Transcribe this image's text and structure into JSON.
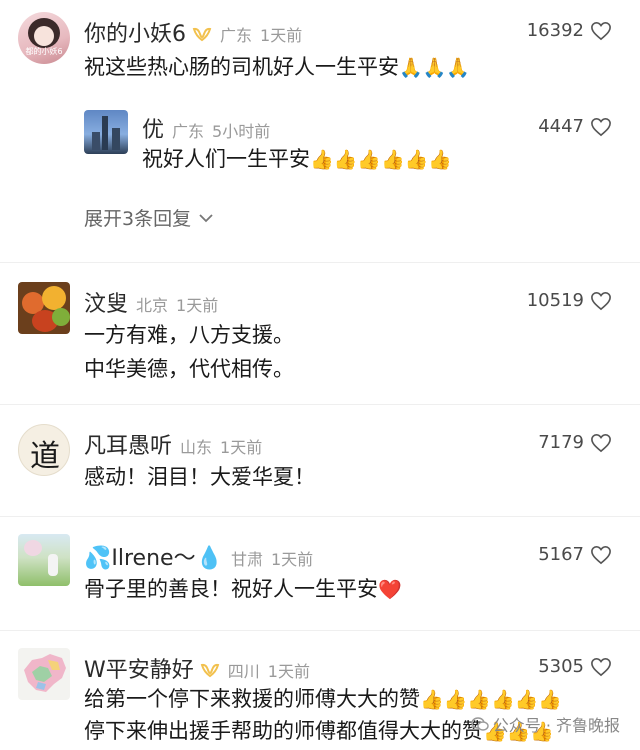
{
  "comments": [
    {
      "user": "你的小妖6",
      "avatar_text": "都的小妖6",
      "location": "广东",
      "time": "1天前",
      "likes": "16392",
      "text": "祝这些热心肠的司机好人一生平安",
      "emoji": "🙏🙏🙏",
      "reply": {
        "user": "优",
        "location": "广东",
        "time": "5小时前",
        "likes": "4447",
        "text": "祝好人们一生平安",
        "emoji": "👍👍👍👍👍👍"
      },
      "expand_label": "展开3条回复"
    },
    {
      "user": "汶叟",
      "location": "北京",
      "time": "1天前",
      "likes": "10519",
      "line1": "一方有难，八方支援。",
      "line2": "中华美德，代代相传。"
    },
    {
      "user": "凡耳愚听",
      "location": "山东",
      "time": "1天前",
      "likes": "7179",
      "text": "感动！泪目！大爱华夏！",
      "avatar_glyph": "道"
    },
    {
      "user": "💦Ilrene～💧",
      "location": "甘肃",
      "time": "1天前",
      "likes": "5167",
      "text": "骨子里的善良！祝好人一生平安",
      "emoji": "❤️"
    },
    {
      "user": "W平安静好",
      "location": "四川",
      "time": "1天前",
      "likes": "5305",
      "line1": "给第一个停下来救援的师傅大大的赞",
      "line1_emoji": "👍👍👍👍👍👍",
      "line2": "停下来伸出援手帮助的师傅都值得大大的赞",
      "line2_emoji": "👍👍👍"
    }
  ],
  "watermark": "公众号 · 齐鲁晚报",
  "colors": {
    "badge": "#f2c14e",
    "meta": "#9a9a9a",
    "heart": "#555555"
  }
}
